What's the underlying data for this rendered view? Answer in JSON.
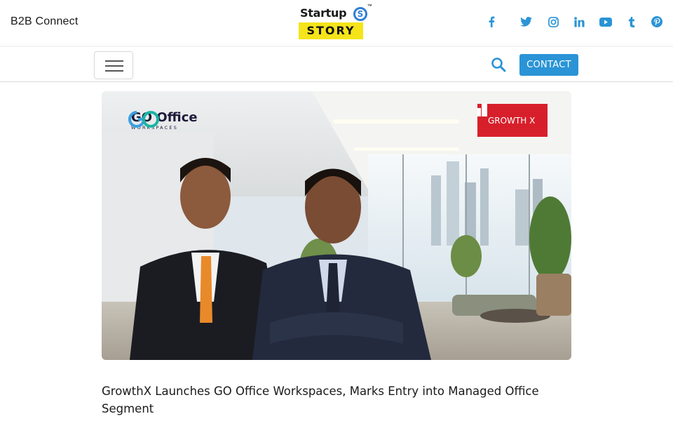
{
  "header": {
    "site_label": "B2B Connect",
    "logo": {
      "line1": "Startup",
      "badge": "S",
      "tm": "™",
      "line2": "STORY"
    },
    "social_icons": [
      "facebook-icon",
      "twitter-icon",
      "instagram-icon",
      "linkedin-icon",
      "youtube-icon",
      "tumblr-icon",
      "pinterest-icon"
    ],
    "icon_color": "#2a94d6"
  },
  "nav": {
    "contact_label": "CONTACT",
    "contact_color": "#2a94d6"
  },
  "article": {
    "image": {
      "left_logo_title": "GO Office",
      "left_logo_sub": "WORKSPACES",
      "right_logo_text": "GROWTH X",
      "right_logo_color": "#d71f2b"
    },
    "headline": "GrowthX Launches GO Office Workspaces, Marks Entry into Managed Office Segment"
  }
}
